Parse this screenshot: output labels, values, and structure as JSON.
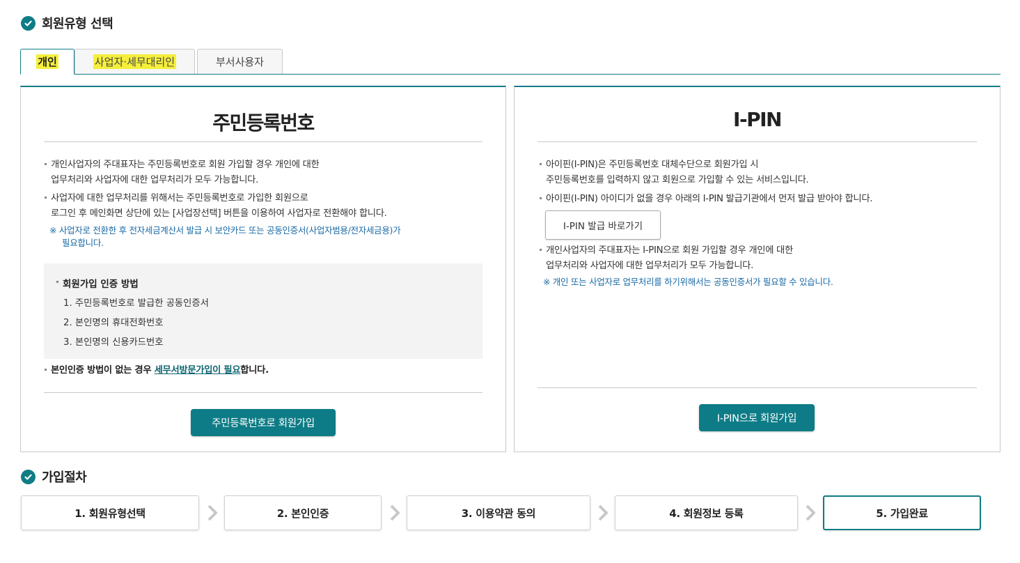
{
  "section1": {
    "title": "회원유형 선택"
  },
  "tabs": [
    {
      "label": "개인",
      "active": true
    },
    {
      "label": "사업자·세무대리인",
      "active": false
    },
    {
      "label": "부서사용자",
      "active": false
    }
  ],
  "left_panel": {
    "title": "주민등록번호",
    "bullets": [
      {
        "line1": "개인사업자의 주대표자는 주민등록번호로 회원 가입할 경우 개인에 대한",
        "line2": "업무처리와 사업자에 대한 업무처리가 모두 가능합니다."
      },
      {
        "line1": "사업자에 대한 업무처리를 위해서는 주민등록번호로 가입한 회원으로",
        "line2": "로그인 후 메인화면 상단에 있는 [사업장선택] 버튼을 이용하여 사업자로 전환해야 합니다."
      }
    ],
    "note": {
      "line1": "※ 사업자로 전환한 후 전자세금계산서 발급 시 보안카드 또는 공동인증서(사업자범용/전자세금용)가",
      "line2": "필요합니다."
    },
    "auth_box": {
      "title": "회원가입 인증 방법",
      "items": [
        "1. 주민등록번호로 발급한 공동인증서",
        "2. 본인명의 휴대전화번호",
        "3. 본인명의 신용카드번호"
      ]
    },
    "footer_text": {
      "prefix": "본인인증 방법이 없는 경우 ",
      "link": "세무서방문가입이 필요",
      "suffix": "합니다."
    },
    "button": "주민등록번호로 회원가입"
  },
  "right_panel": {
    "title": "I-PIN",
    "bullet1": {
      "line1": "아이핀(I-PIN)은 주민등록번호 대체수단으로 회원가입 시",
      "line2": "주민등록번호를 입력하지 않고 회원으로 가입할 수 있는 서비스입니다."
    },
    "bullet2": "아이핀(I-PIN) 아이디가 없을 경우 아래의 I-PIN 발급기관에서 먼저 발급 받아야 합니다.",
    "issue_button": "I-PIN 발급 바로가기",
    "bullet3": {
      "line1": "개인사업자의 주대표자는 I-PIN으로 회원 가입할 경우 개인에 대한",
      "line2": "업무처리와 사업자에 대한 업무처리가 모두 가능합니다."
    },
    "note": "※ 개인 또는 사업자로 업무처리를 하기위해서는 공동인증서가 필요할 수 있습니다.",
    "button": "I-PIN으로 회원가입"
  },
  "section2": {
    "title": "가입절차"
  },
  "steps": [
    "1. 회원유형선택",
    "2. 본인인증",
    "3. 이용약관 동의",
    "4. 회원정보 등록",
    "5. 가입완료"
  ],
  "colors": {
    "accent": "#0e7c86",
    "note": "#1a6aa5",
    "tab_highlight": "#f5ef3c"
  }
}
